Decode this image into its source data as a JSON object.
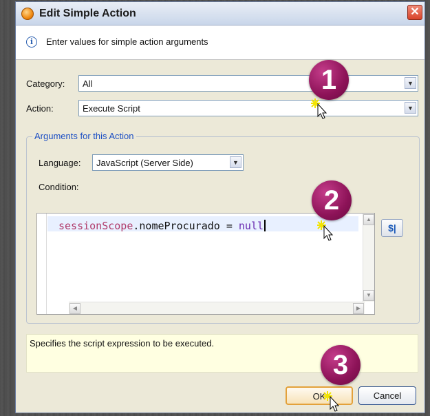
{
  "dialog": {
    "title": "Edit Simple Action",
    "close_glyph": "✕",
    "info_glyph": "i",
    "info_text": "Enter values for simple action arguments"
  },
  "form": {
    "category_label": "Category:",
    "category_value": "All",
    "action_label": "Action:",
    "action_value": "Execute Script",
    "combo_arrow_glyph": "▼"
  },
  "arguments": {
    "group_title": "Arguments for this Action",
    "language_label": "Language:",
    "language_value": "JavaScript (Server Side)",
    "condition_label": "Condition:"
  },
  "editor": {
    "code_var": "sessionScope",
    "code_plain": ".nomeProcurado = ",
    "code_kw": "null",
    "script_button_label": "$|",
    "scroll_up_glyph": "▲",
    "scroll_down_glyph": "▼",
    "scroll_left_glyph": "◀",
    "scroll_right_glyph": "▶"
  },
  "description": "Specifies the script expression to be executed.",
  "buttons": {
    "ok": "OK",
    "cancel": "Cancel"
  },
  "steps": [
    "1",
    "2",
    "3"
  ],
  "colors": {
    "step_badge": "#8d1358",
    "ok_border": "#e3a13a",
    "group_title": "#1c4fc4"
  }
}
